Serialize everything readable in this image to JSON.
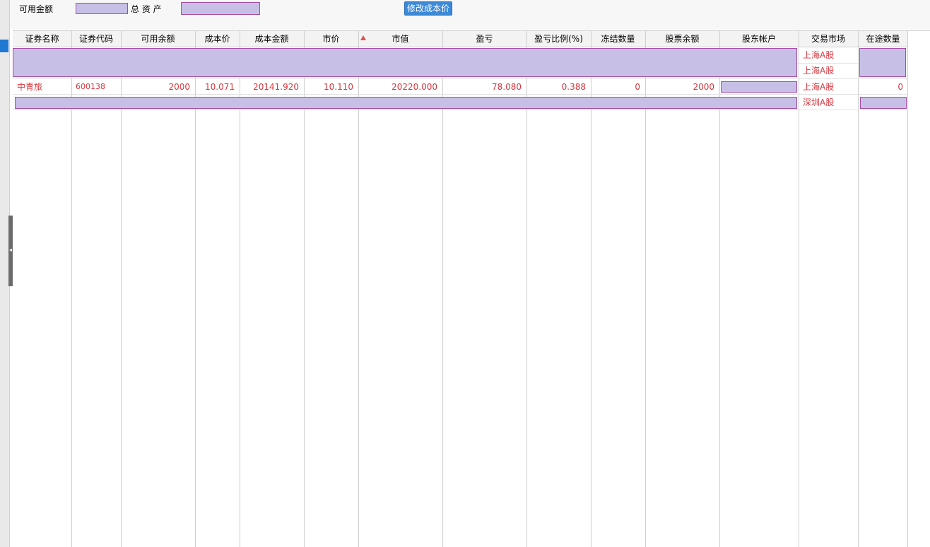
{
  "top_bar": {
    "available_amount_label": "可用金额",
    "total_assets_label": "总 资 产",
    "edit_cost_button": "修改成本价"
  },
  "table": {
    "columns": [
      "证券名称",
      "证券代码",
      "可用余额",
      "成本价",
      "成本金额",
      "市价",
      "市值",
      "盈亏",
      "盈亏比例(%)",
      "冻结数量",
      "股票余额",
      "股东帐户",
      "交易市场",
      "在途数量"
    ],
    "sort_column": "市值",
    "rows": [
      {
        "market": "上海A股"
      },
      {
        "market": "上海A股"
      },
      {
        "name": "中青旅",
        "code": "600138",
        "available": "2000",
        "cost_price": "10.071",
        "cost_amount": "20141.920",
        "market_price": "10.110",
        "market_value": "20220.000",
        "profit_loss": "78.080",
        "pl_ratio": "0.388",
        "frozen": "0",
        "stock_balance": "2000",
        "market": "上海A股",
        "in_transit": "0"
      },
      {
        "market": "深圳A股"
      }
    ]
  },
  "colors": {
    "redaction_fill": "#c8bfe7",
    "redaction_border": "#a64ca6",
    "row_text": "#d9363e",
    "button": "#3b8ad8"
  }
}
